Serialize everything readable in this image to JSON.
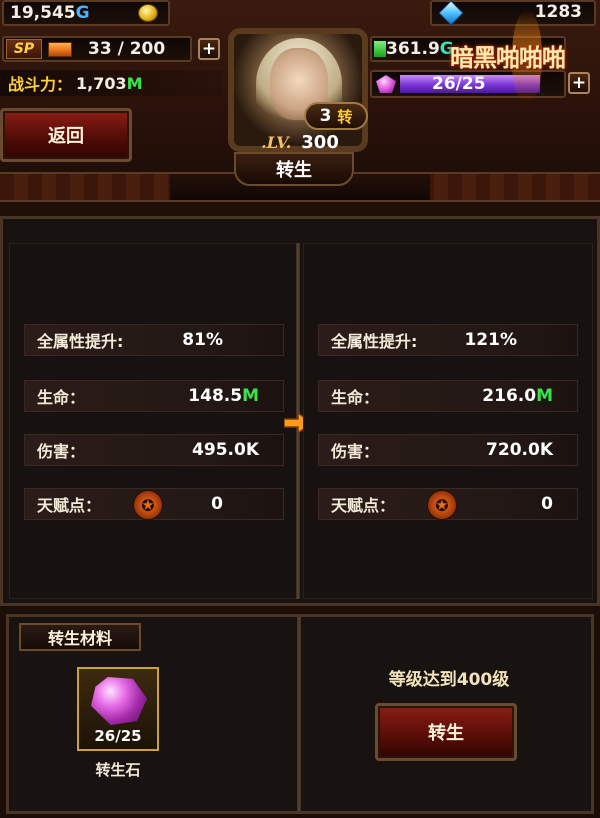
{
  "header": {
    "gold": "19,545",
    "gold_unit": "G",
    "diamonds": "1283",
    "sp_label": "SP",
    "sp": "33 / 200",
    "plus_label": "+",
    "energy": "361.9",
    "energy_unit": "G",
    "gems": "26/25",
    "power_label": "战斗力：",
    "power_value": "1,703",
    "power_unit": "M",
    "logo_text": "暗黑啪啪啪"
  },
  "back_button": {
    "label": "返回"
  },
  "character": {
    "rebirth_count": "3",
    "rebirth_suffix": "转",
    "level_label": ".LV.",
    "level": "300",
    "title": "转生"
  },
  "stats": {
    "current": {
      "attr_label": "全属性提升:",
      "attr_value": "81%",
      "hp_label": "生命：",
      "hp_value": "148.5",
      "hp_unit": "M",
      "damage_label": "伤害：",
      "damage_value": "495.0K",
      "talent_label": "天赋点：",
      "talent_value": "0"
    },
    "next": {
      "attr_label": "全属性提升:",
      "attr_value": "121%",
      "hp_label": "生命：",
      "hp_value": "216.0",
      "hp_unit": "M",
      "damage_label": "伤害：",
      "damage_value": "720.0K",
      "talent_label": "天赋点：",
      "talent_value": "0"
    }
  },
  "materials": {
    "title": "转生材料",
    "item_count": "26/25",
    "item_name": "转生石"
  },
  "requirement": {
    "text": "等级达到400级",
    "button_label": "转生"
  },
  "icons": {
    "gold": "gold-coin-icon",
    "diamond": "diamond-icon",
    "gem": "purple-gem-icon",
    "talent": "pentagram-icon",
    "arrow": "right-arrow-icon"
  },
  "colors": {
    "unit_green": "#38e44a",
    "gold_unit_blue": "#4ab3ff",
    "label_gold": "#ffcc3a",
    "button_red": "#8a1e14"
  }
}
